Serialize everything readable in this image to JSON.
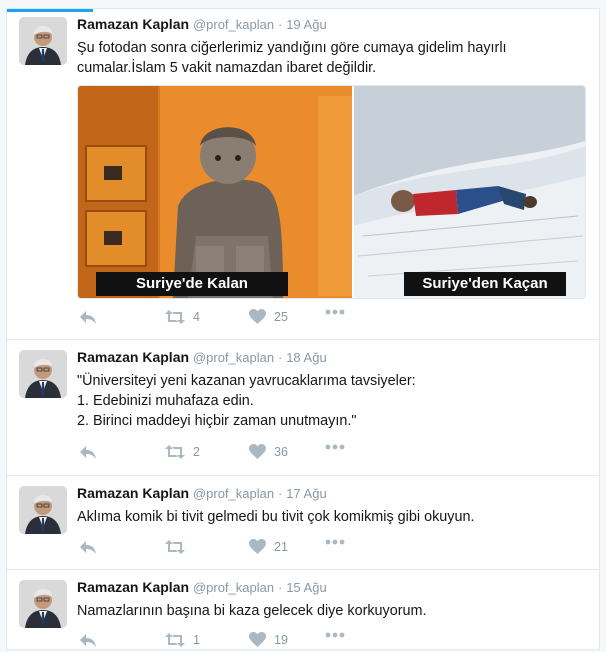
{
  "tweets": [
    {
      "name": "Ramazan Kaplan",
      "handle": "@prof_kaplan",
      "separator": "·",
      "time": "19 Ağu",
      "lines": [
        "Şu fotodan sonra ciğerlerimiz yandığını göre cumaya gidelim hayırlı",
        "cumalar.İslam 5 vakit namazdan ibaret değildir."
      ],
      "media": {
        "left_caption": "Suriye'de Kalan",
        "right_caption": "Suriye'den Kaçan"
      },
      "retweets": "4",
      "likes": "25"
    },
    {
      "name": "Ramazan Kaplan",
      "handle": "@prof_kaplan",
      "separator": "·",
      "time": "18 Ağu",
      "lines": [
        "\"Üniversiteyi yeni kazanan yavrucaklarıma tavsiyeler:",
        "1. Edebinizi muhafaza edin.",
        "2. Birinci maddeyi hiçbir zaman unutmayın.\""
      ],
      "retweets": "2",
      "likes": "36"
    },
    {
      "name": "Ramazan Kaplan",
      "handle": "@prof_kaplan",
      "separator": "·",
      "time": "17 Ağu",
      "lines": [
        "Aklıma komik bi tivit gelmedi bu tivit çok komikmiş gibi okuyun."
      ],
      "retweets": "",
      "likes": "21"
    },
    {
      "name": "Ramazan Kaplan",
      "handle": "@prof_kaplan",
      "separator": "·",
      "time": "15 Ağu",
      "lines": [
        "Namazlarının başına bi kaza gelecek diye korkuyorum."
      ],
      "retweets": "1",
      "likes": "19"
    }
  ],
  "icons": {
    "reply": "reply-icon",
    "retweet": "retweet-icon",
    "like": "heart-icon",
    "more": "more-icon"
  },
  "colors": {
    "accent": "#1da1f2",
    "muted": "#8899a6",
    "caption_bg": "#111111"
  }
}
